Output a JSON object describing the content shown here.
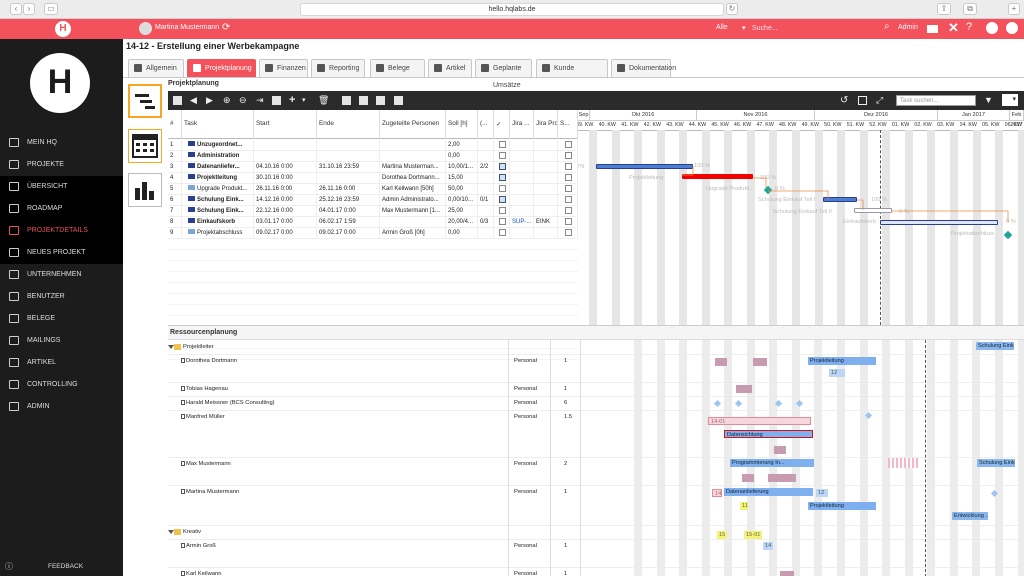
{
  "browser": {
    "url": "hello.hqlabs.de"
  },
  "appbar": {
    "user": "Martina Mustermann",
    "scope": "Alle",
    "search_placeholder": "Suche...",
    "admin": "Admin"
  },
  "sidebar": {
    "logo": "H",
    "items": [
      {
        "label": "MEIN HQ",
        "state": "normal"
      },
      {
        "label": "PROJEKTE",
        "state": "normal"
      },
      {
        "label": "ÜBERSICHT",
        "state": "sub"
      },
      {
        "label": "ROADMAP",
        "state": "sub"
      },
      {
        "label": "PROJEKTDETAILS",
        "state": "active"
      },
      {
        "label": "NEUES PROJEKT",
        "state": "sub"
      },
      {
        "label": "UNTERNEHMEN",
        "state": "normal"
      },
      {
        "label": "BENUTZER",
        "state": "normal"
      },
      {
        "label": "BELEGE",
        "state": "normal"
      },
      {
        "label": "MAILINGS",
        "state": "normal"
      },
      {
        "label": "ARTIKEL",
        "state": "normal"
      },
      {
        "label": "CONTROLLING",
        "state": "normal"
      },
      {
        "label": "ADMIN",
        "state": "normal"
      }
    ],
    "feedback": "FEEDBACK"
  },
  "page": {
    "title": "14-12 - Erstellung einer Werbekampagne",
    "tabs": [
      "Allgemein",
      "Projektplanung",
      "Finanzen",
      "Reporting",
      "Belege",
      "Artikel",
      "Geplante Umsätze",
      "Kunde",
      "Dokumentation"
    ],
    "active_tab": "Projektplanung",
    "section_planning": "Projektplanung",
    "section_resources": "Ressourcenplanung",
    "task_search_placeholder": "Task suchen..."
  },
  "grid": {
    "columns": [
      "#",
      "Task",
      "Start",
      "Ende",
      "Zugeteilte Personen",
      "Soll [h]",
      "(...",
      "✓",
      "Jira ...",
      "Jira Proje...",
      "S..."
    ],
    "rows": [
      {
        "n": "1",
        "task": "Unzugeordnet...",
        "start": "",
        "end": "",
        "persons": "",
        "soll": "2,00",
        "p": "",
        "done": false,
        "jira": "",
        "jproj": "",
        "bold": true
      },
      {
        "n": "2",
        "task": "Administration",
        "start": "",
        "end": "",
        "persons": "",
        "soll": "0,00",
        "p": "",
        "done": false,
        "jira": "",
        "jproj": "",
        "bold": true
      },
      {
        "n": "3",
        "task": "Datenanliefer...",
        "start": "04.10.16 0:00",
        "end": "31.10.16 23:59",
        "persons": "Martina Musterman...",
        "soll": "10,00/1...",
        "p": "2/2",
        "done": true,
        "jira": "",
        "jproj": "",
        "bold": true
      },
      {
        "n": "4",
        "task": "Projektleitung",
        "start": "30.10.16 0:00",
        "end": "",
        "persons": "Dorothea Dortmann...",
        "soll": "15,00",
        "p": "",
        "done": true,
        "jira": "",
        "jproj": "",
        "bold": true
      },
      {
        "n": "5",
        "task": "Upgrade Produkt...",
        "start": "26.11.16 0:00",
        "end": "26.11.16 0:00",
        "persons": "Karl Keilwann [50h]",
        "soll": "50,00",
        "p": "",
        "done": false,
        "jira": "",
        "jproj": "",
        "bold": false
      },
      {
        "n": "6",
        "task": "Schulung Eink...",
        "start": "14.12.16 0:00",
        "end": "25.12.16 23:59",
        "persons": "Admin Administrato...",
        "soll": "0,00/10...",
        "p": "0/1",
        "done": true,
        "jira": "",
        "jproj": "",
        "bold": true
      },
      {
        "n": "7",
        "task": "Schulung Eink...",
        "start": "22.12.16 0:00",
        "end": "04.01.17 0:00",
        "persons": "Max Mustermann [1...",
        "soll": "25,00",
        "p": "",
        "done": false,
        "jira": "",
        "jproj": "",
        "bold": true
      },
      {
        "n": "8",
        "task": "Einkaufskorb",
        "start": "03.01.17 0:00",
        "end": "06.02.17 1:59",
        "persons": "",
        "soll": "20,00/4...",
        "p": "0/3",
        "done": false,
        "jira": "SUP-...",
        "jproj": "EINK",
        "bold": true
      },
      {
        "n": "9",
        "task": "Projektabschluss",
        "start": "09.02.17 0:00",
        "end": "09.02.17 0:00",
        "persons": "Armin Groß [0h]",
        "soll": "0,00",
        "p": "",
        "done": false,
        "jira": "",
        "jproj": "",
        "bold": false
      }
    ]
  },
  "gantt": {
    "months": [
      "Sep",
      "Okt 2016",
      "Nov 2016",
      "Dez 2016",
      "Jan 2017",
      "Feb 2017"
    ],
    "weeks": [
      "39. KW",
      "40. KW",
      "41. KW",
      "42. KW",
      "43. KW",
      "44. KW",
      "45. KW",
      "46. KW",
      "47. KW",
      "48. KW",
      "49. KW",
      "50. KW",
      "51. KW",
      "52. KW",
      "01. KW",
      "02. KW",
      "03. KW",
      "04. KW",
      "05. KW",
      "06. KW"
    ],
    "labels": {
      "r3": "ung",
      "r3pct": "100 %",
      "r4": "Projektleitung",
      "r4pct": "100 %",
      "r5": "Upgrade Produkt...",
      "r5pct": "0 %",
      "r6": "Schulung Einkauf Teil I",
      "r6pct": "100 %",
      "r7": "Schulung Einkauf Teil II",
      "r7pct": "0 %",
      "r8": "Einkaufskorb",
      "r8pct": "0 %",
      "r9": "Projektabschluss"
    }
  },
  "resources": {
    "rows": [
      {
        "name": "Projektleiter",
        "type": "",
        "n": "",
        "group": true,
        "blocks": [
          "Schulung Eink..."
        ]
      },
      {
        "name": "Dorothea Dortmann",
        "type": "Personal",
        "n": "1",
        "group": false,
        "blocks": [
          "Projektleitung",
          "12"
        ]
      },
      {
        "name": "Tobias Hagenau",
        "type": "Personal",
        "n": "1",
        "group": false,
        "blocks": []
      },
      {
        "name": "Harald Meissner (BCS Consulting)",
        "type": "Personal",
        "n": "6",
        "group": false,
        "blocks": []
      },
      {
        "name": "Manfred Müller",
        "type": "Personal",
        "n": "1.5",
        "group": false,
        "blocks": [
          "14-01",
          "Datensichtung"
        ]
      },
      {
        "name": "Max Mustermann",
        "type": "Personal",
        "n": "2",
        "group": false,
        "blocks": [
          "Programmierung In...",
          "Schulung Eink..."
        ]
      },
      {
        "name": "Martina Mustermann",
        "type": "Personal",
        "n": "1",
        "group": false,
        "blocks": [
          "14",
          "Datenanlieferung",
          "12",
          "Projektleitung",
          "11"
        ]
      },
      {
        "name": "Kreativ",
        "type": "",
        "n": "",
        "group": true,
        "blocks": [
          "Entwicklung ..."
        ]
      },
      {
        "name": "Armin Groß",
        "type": "Personal",
        "n": "1",
        "group": false,
        "blocks": [
          "15",
          "15-01",
          "14"
        ]
      },
      {
        "name": "Karl Keilwann",
        "type": "Personal",
        "n": "1",
        "group": false,
        "blocks": []
      }
    ]
  }
}
